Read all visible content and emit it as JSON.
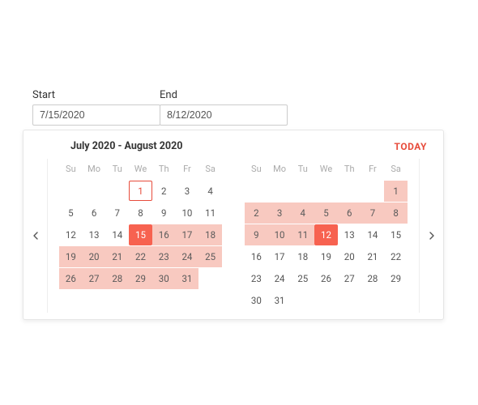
{
  "fields": {
    "start_label": "Start",
    "start_value": "7/15/2020",
    "end_label": "End",
    "end_value": "8/12/2020"
  },
  "popup": {
    "range_title": "July 2020 - August 2020",
    "today_label": "TODAY",
    "dow": [
      "Su",
      "Mo",
      "Tu",
      "We",
      "Th",
      "Fr",
      "Sa"
    ]
  },
  "months": [
    {
      "name": "July 2020",
      "weeks": [
        [
          null,
          null,
          null,
          {
            "v": "1",
            "t": "today-outline"
          },
          {
            "v": "2"
          },
          {
            "v": "3"
          },
          {
            "v": "4"
          }
        ],
        [
          {
            "v": "5"
          },
          {
            "v": "6"
          },
          {
            "v": "7"
          },
          {
            "v": "8"
          },
          {
            "v": "9"
          },
          {
            "v": "10"
          },
          {
            "v": "11"
          }
        ],
        [
          {
            "v": "12"
          },
          {
            "v": "13"
          },
          {
            "v": "14"
          },
          {
            "v": "15",
            "t": "selected"
          },
          {
            "v": "16",
            "t": "in-range"
          },
          {
            "v": "17",
            "t": "in-range"
          },
          {
            "v": "18",
            "t": "in-range"
          }
        ],
        [
          {
            "v": "19",
            "t": "in-range"
          },
          {
            "v": "20",
            "t": "in-range"
          },
          {
            "v": "21",
            "t": "in-range"
          },
          {
            "v": "22",
            "t": "in-range"
          },
          {
            "v": "23",
            "t": "in-range"
          },
          {
            "v": "24",
            "t": "in-range"
          },
          {
            "v": "25",
            "t": "in-range"
          }
        ],
        [
          {
            "v": "26",
            "t": "in-range"
          },
          {
            "v": "27",
            "t": "in-range"
          },
          {
            "v": "28",
            "t": "in-range"
          },
          {
            "v": "29",
            "t": "in-range"
          },
          {
            "v": "30",
            "t": "in-range"
          },
          {
            "v": "31",
            "t": "in-range"
          },
          null
        ]
      ]
    },
    {
      "name": "August 2020",
      "weeks": [
        [
          null,
          null,
          null,
          null,
          null,
          null,
          {
            "v": "1",
            "t": "in-range"
          }
        ],
        [
          {
            "v": "2",
            "t": "in-range"
          },
          {
            "v": "3",
            "t": "in-range"
          },
          {
            "v": "4",
            "t": "in-range"
          },
          {
            "v": "5",
            "t": "in-range"
          },
          {
            "v": "6",
            "t": "in-range"
          },
          {
            "v": "7",
            "t": "in-range"
          },
          {
            "v": "8",
            "t": "in-range"
          }
        ],
        [
          {
            "v": "9",
            "t": "in-range"
          },
          {
            "v": "10",
            "t": "in-range"
          },
          {
            "v": "11",
            "t": "in-range"
          },
          {
            "v": "12",
            "t": "selected"
          },
          {
            "v": "13"
          },
          {
            "v": "14"
          },
          {
            "v": "15"
          }
        ],
        [
          {
            "v": "16"
          },
          {
            "v": "17"
          },
          {
            "v": "18"
          },
          {
            "v": "19"
          },
          {
            "v": "20"
          },
          {
            "v": "21"
          },
          {
            "v": "22"
          }
        ],
        [
          {
            "v": "23"
          },
          {
            "v": "24"
          },
          {
            "v": "25"
          },
          {
            "v": "26"
          },
          {
            "v": "27"
          },
          {
            "v": "28"
          },
          {
            "v": "29"
          }
        ],
        [
          {
            "v": "30"
          },
          {
            "v": "31"
          },
          null,
          null,
          null,
          null,
          null
        ]
      ]
    }
  ]
}
